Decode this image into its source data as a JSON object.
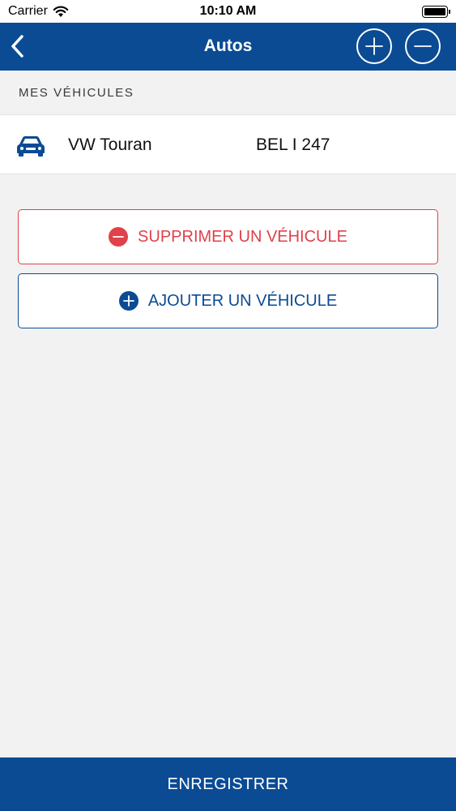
{
  "status_bar": {
    "carrier": "Carrier",
    "time": "10:10 AM"
  },
  "nav": {
    "title": "Autos"
  },
  "section": {
    "header": "MES VÉHICULES"
  },
  "vehicles": [
    {
      "name": "VW Touran",
      "plate": "BEL I 247"
    }
  ],
  "actions": {
    "delete_label": "SUPPRIMER UN VÉHICULE",
    "add_label": "AJOUTER UN VÉHICULE"
  },
  "footer": {
    "save_label": "ENREGISTRER"
  },
  "colors": {
    "primary": "#0b4b94",
    "danger": "#e0414a",
    "background": "#f2f2f2"
  }
}
